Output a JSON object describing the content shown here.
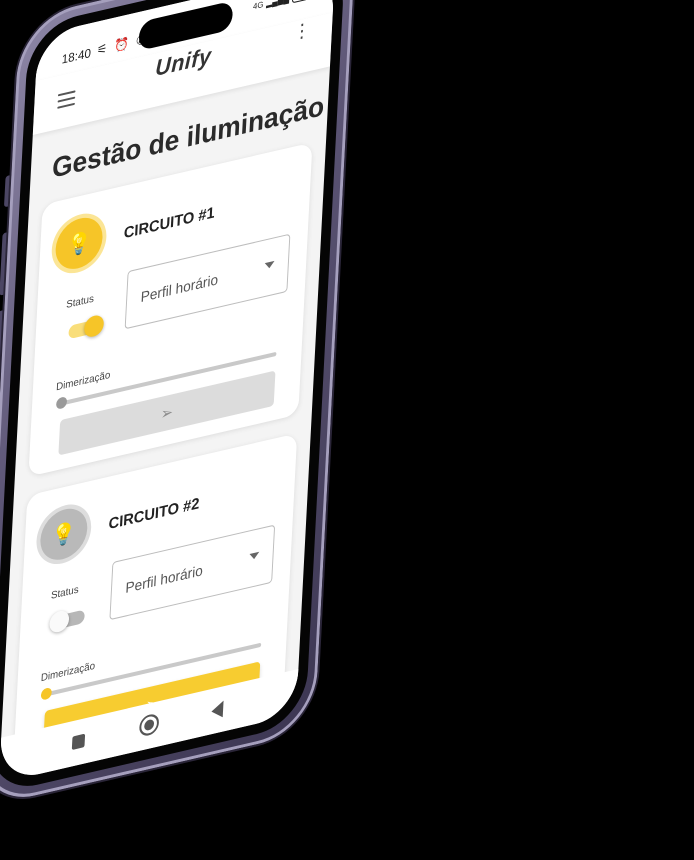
{
  "status_bar": {
    "time": "18:40",
    "icons": "⚟ ⏰ ✆ ▣",
    "network": "4G",
    "battery": "38"
  },
  "app_bar": {
    "logo": "Unify",
    "kebab": "⋮"
  },
  "page": {
    "title": "Gestão de iluminação"
  },
  "circuits": [
    {
      "title": "CIRCUITO #1",
      "status_label": "Status",
      "status_on": true,
      "profile_value": "Perfil horário",
      "dim_label": "Dimerização",
      "dim_value": 0,
      "send_enabled": false,
      "send_icon": "➢"
    },
    {
      "title": "CIRCUITO #2",
      "status_label": "Status",
      "status_on": false,
      "profile_value": "Perfil horário",
      "dim_label": "Dimerização",
      "dim_value": 0,
      "send_enabled": true,
      "send_icon": "➢"
    }
  ],
  "colors": {
    "accent": "#f6c528",
    "accent_light": "#fbe596",
    "inactive": "#b9b9b9",
    "phone_frame": "#5b5474"
  },
  "icons": {
    "bulb": "lightbulb-icon",
    "send": "send-icon",
    "menu": "hamburger-menu-icon"
  }
}
